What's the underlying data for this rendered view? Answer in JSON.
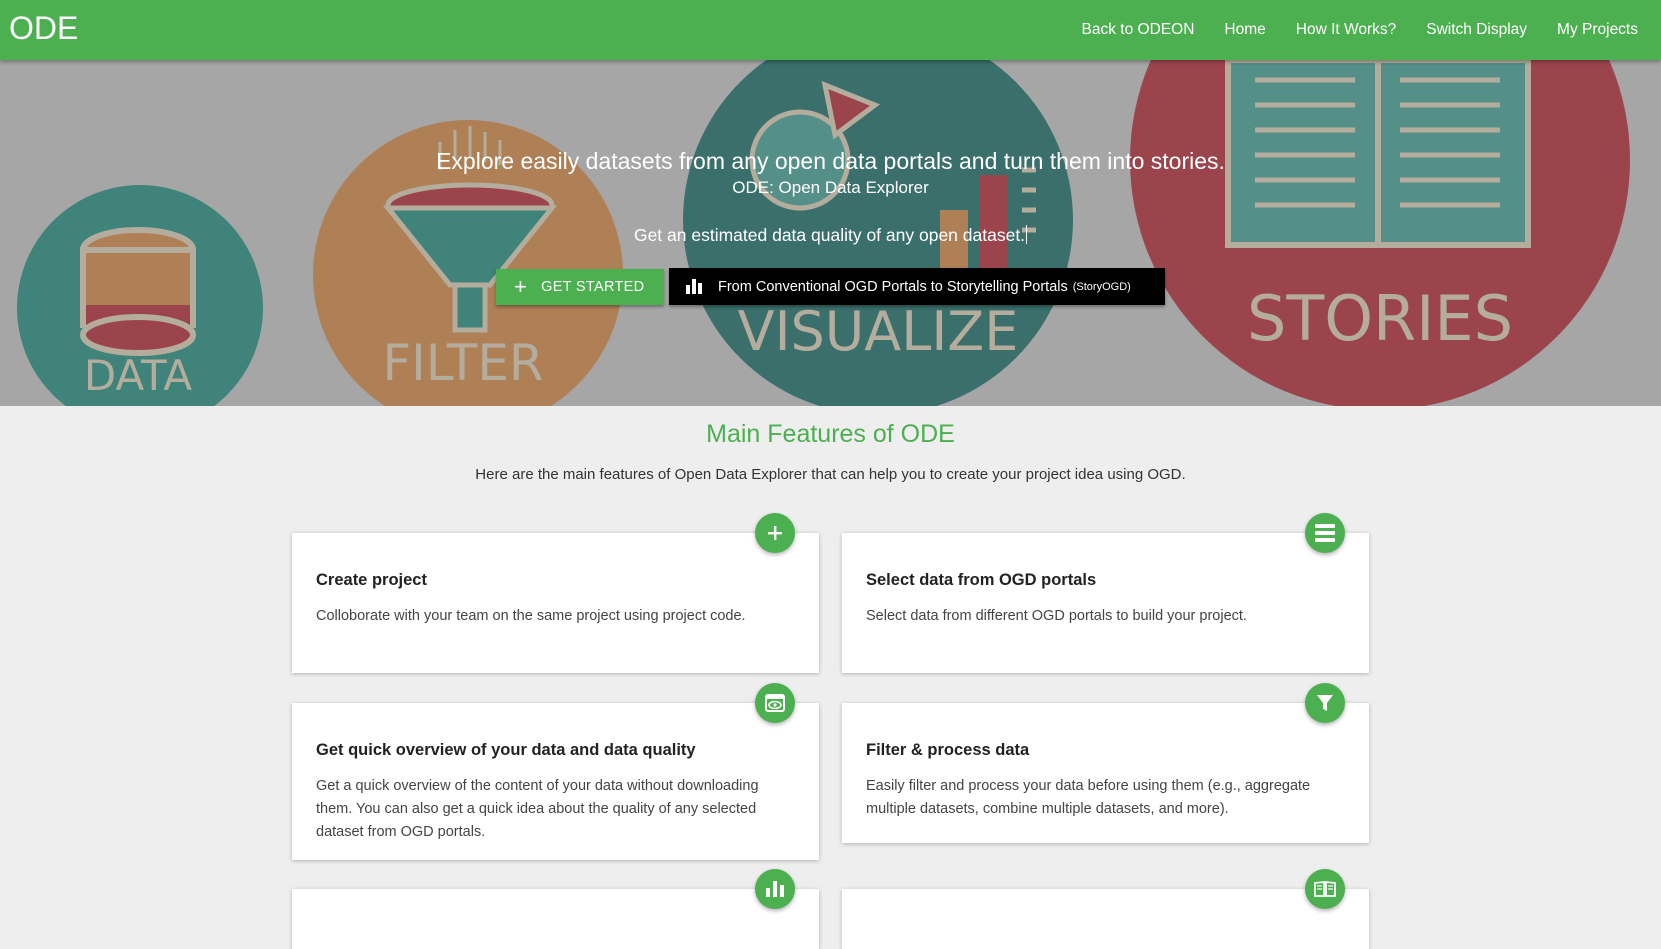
{
  "navbar": {
    "brand": "ODE",
    "links": [
      "Back to ODEON",
      "Home",
      "How It Works?",
      "Switch Display",
      "My Projects"
    ]
  },
  "hero": {
    "title": "Explore easily datasets from any open data portals and turn them into stories.",
    "subtitle": "ODE: Open Data Explorer",
    "typed_text": "Get an estimated data quality of any open dataset.",
    "start_button": "GET STARTED",
    "story_button": "From Conventional OGD Portals to Storytelling Portals",
    "story_button_small": "(StoryOGD)",
    "background_labels": [
      "DATA",
      "FILTER",
      "VISUALIZE",
      "STORIES"
    ]
  },
  "features": {
    "title": "Main Features of ODE",
    "description": "Here are the main features of Open Data Explorer that can help you to create your project idea using OGD.",
    "cards": [
      {
        "title": "Create project",
        "text": "Colloborate with your team on the same project using project code.",
        "icon": "plus-icon"
      },
      {
        "title": "Select data from OGD portals",
        "text": "Select data from different OGD portals to build your project.",
        "icon": "list-icon"
      },
      {
        "title": "Get quick overview of your data and data quality",
        "text": "Get a quick overview of the content of your data without downloading them. You can also get a quick idea about the quality of any selected dataset from OGD portals.",
        "icon": "preview-icon"
      },
      {
        "title": "Filter & process data",
        "text": "Easily filter and process your data before using them (e.g., aggregate multiple datasets, combine multiple datasets, and more).",
        "icon": "filter-icon"
      },
      {
        "title": "",
        "text": "",
        "icon": "chart-icon"
      },
      {
        "title": "",
        "text": "",
        "icon": "book-icon"
      }
    ]
  },
  "colors": {
    "primary": "#4caf50",
    "teal": "#2a9d8f",
    "orange": "#e8964f",
    "red": "#c8313f"
  }
}
